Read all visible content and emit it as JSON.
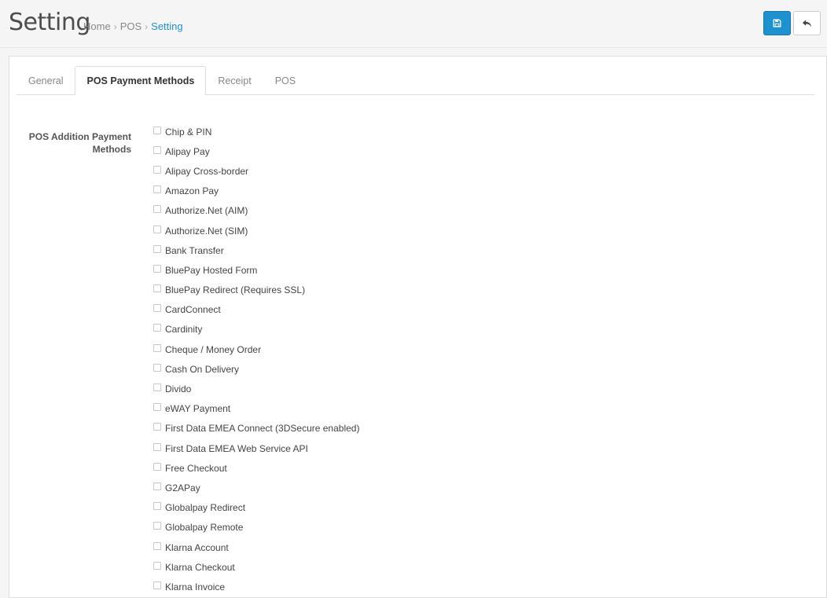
{
  "header": {
    "title": "Setting",
    "breadcrumb": [
      {
        "label": "Home"
      },
      {
        "label": "POS"
      },
      {
        "label": "Setting"
      }
    ],
    "breadcrumb_separator": "›",
    "actions": [
      {
        "name": "save-button",
        "icon": "save-icon"
      },
      {
        "name": "back-button",
        "icon": "reply-icon"
      }
    ]
  },
  "colors": {
    "primary": "#1e91cf",
    "link": "#1e91cf",
    "text": "#333333"
  },
  "tabs": [
    {
      "label": "General",
      "active": false
    },
    {
      "label": "POS Payment Methods",
      "active": true
    },
    {
      "label": "Receipt",
      "active": false
    },
    {
      "label": "POS",
      "active": false
    }
  ],
  "form": {
    "label": "POS Addition Payment Methods",
    "options": [
      "Chip & PIN",
      "Alipay Pay",
      "Alipay Cross-border",
      "Amazon Pay",
      "Authorize.Net (AIM)",
      "Authorize.Net (SIM)",
      "Bank Transfer",
      "BluePay Hosted Form",
      "BluePay Redirect (Requires SSL)",
      "CardConnect",
      "Cardinity",
      "Cheque / Money Order",
      "Cash On Delivery",
      "Divido",
      "eWAY Payment",
      "First Data EMEA Connect (3DSecure enabled)",
      "First Data EMEA Web Service API",
      "Free Checkout",
      "G2APay",
      "Globalpay Redirect",
      "Globalpay Remote",
      "Klarna Account",
      "Klarna Checkout",
      "Klarna Invoice"
    ]
  }
}
